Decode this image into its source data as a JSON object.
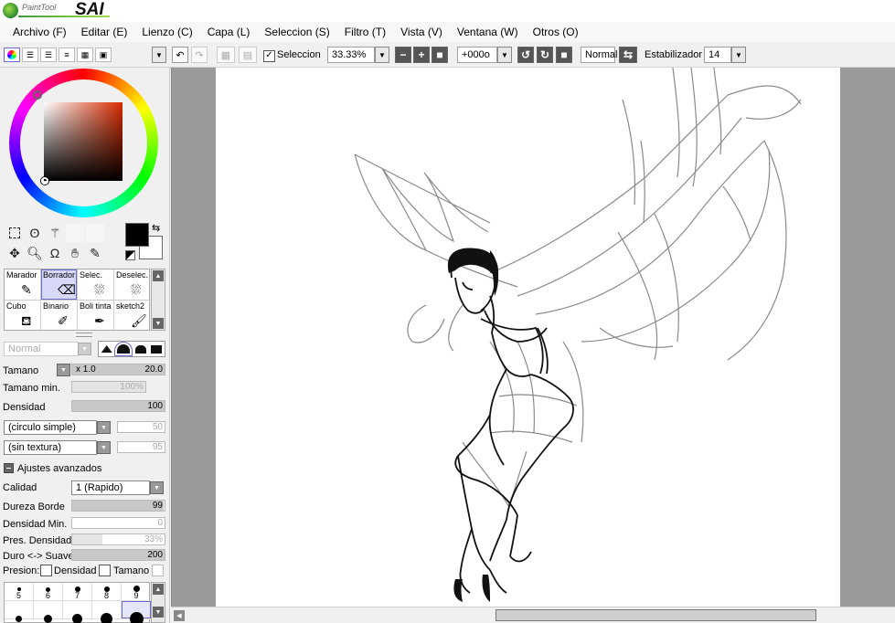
{
  "app": {
    "logo_small": "PaintTool",
    "logo_big": "SAI"
  },
  "menu": [
    "Archivo (F)",
    "Editar (E)",
    "Lienzo (C)",
    "Capa (L)",
    "Seleccion (S)",
    "Filtro (T)",
    "Vista (V)",
    "Ventana (W)",
    "Otros (O)"
  ],
  "toolbar": {
    "selection_label": "Seleccion",
    "selection_checked": true,
    "zoom": "33.33%",
    "rotation": "+000o",
    "blend_mode": "Normal",
    "stabilizer_label": "Estabilizador",
    "stabilizer_value": "14"
  },
  "color": {
    "foreground": "#000000",
    "background": "#ffffff",
    "hue": "#d62b00"
  },
  "brushes": [
    {
      "name": "Marador",
      "icon": "pen-icon",
      "selected": false
    },
    {
      "name": "Borrador",
      "icon": "eraser-icon",
      "selected": true
    },
    {
      "name": "Selec.",
      "icon": "select-brush-icon",
      "selected": false
    },
    {
      "name": "Deselec.",
      "icon": "deselect-brush-icon",
      "selected": false
    },
    {
      "name": "Cubo",
      "icon": "bucket-icon",
      "selected": false
    },
    {
      "name": "Binario",
      "icon": "binary-pen-icon",
      "selected": false
    },
    {
      "name": "Boli tinta",
      "icon": "ink-pen-icon",
      "selected": false
    },
    {
      "name": "sketch2",
      "icon": "brush-icon",
      "selected": false
    }
  ],
  "props": {
    "blend_mode": "Normal",
    "tamano_label": "Tamano",
    "tamano_mult": "x 1.0",
    "tamano_value": "20.0",
    "tamano_min_label": "Tamano min.",
    "tamano_min_value": "100%",
    "densidad_label": "Densidad",
    "densidad_value": "100",
    "shape": "(circulo simple)",
    "shape_value": "50",
    "texture": "(sin textura)",
    "texture_value": "95",
    "advanced_label": "Ajustes avanzados",
    "calidad_label": "Calidad",
    "calidad_value": "1 (Rapido)",
    "dureza_label": "Dureza Borde",
    "dureza_value": "99",
    "dens_min_label": "Densidad Min.",
    "dens_min_value": "0",
    "pres_label": "Pres. Densidad M",
    "pres_value": "33%",
    "duro_label": "Duro <-> Suave",
    "duro_value": "200",
    "presion_label": "Presion:",
    "presion_dens": "Densidad",
    "presion_tam": "Tamano"
  },
  "dot_sizes": [
    "5",
    "6",
    "7",
    "8",
    "9"
  ]
}
